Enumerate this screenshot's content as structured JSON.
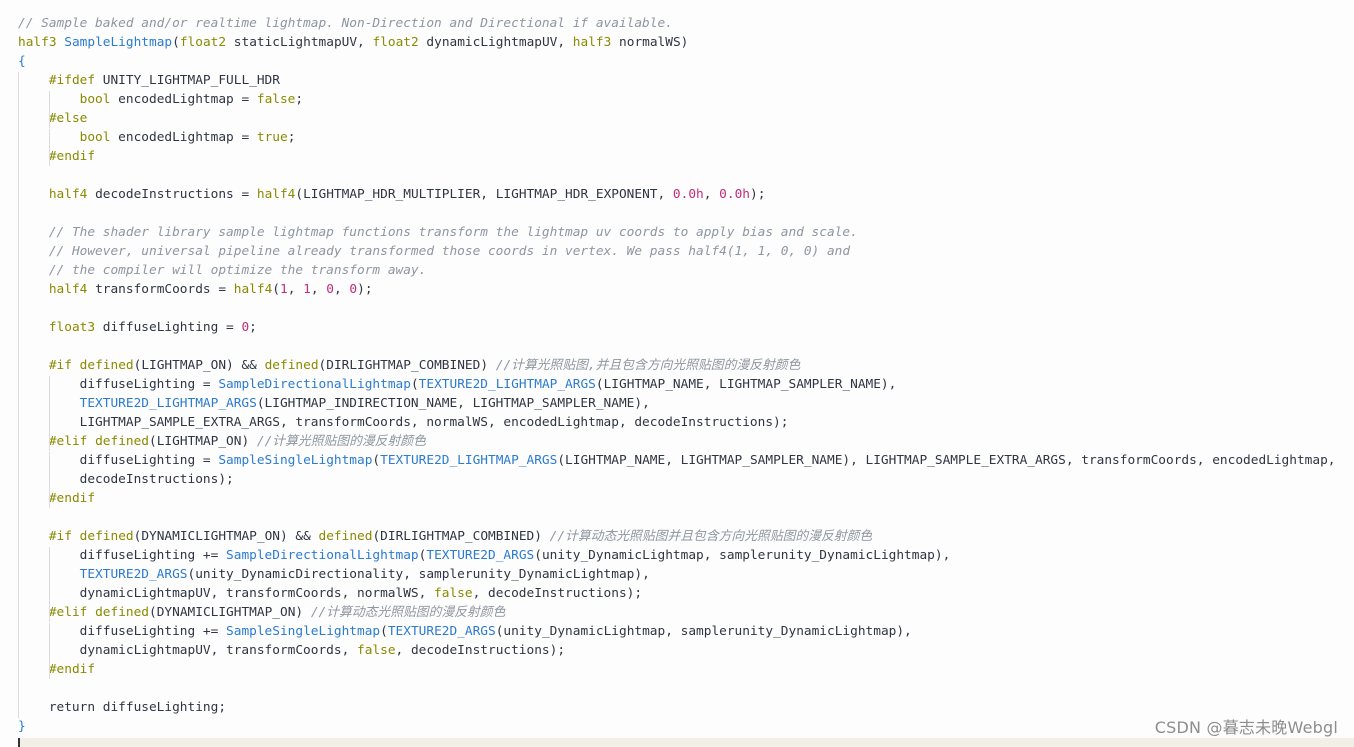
{
  "watermark": "CSDN @暮志未晚Webgl",
  "code_lines": [
    [
      [
        "cm",
        "// Sample baked and/or realtime lightmap. Non-Direction and Directional if available."
      ]
    ],
    [
      [
        "kw",
        "half3"
      ],
      [
        "txt",
        " "
      ],
      [
        "fn",
        "SampleLightmap"
      ],
      [
        "txt",
        "("
      ],
      [
        "kw",
        "float2"
      ],
      [
        "txt",
        " staticLightmapUV, "
      ],
      [
        "kw",
        "float2"
      ],
      [
        "txt",
        " dynamicLightmapUV, "
      ],
      [
        "kw",
        "half3"
      ],
      [
        "txt",
        " normalWS)"
      ]
    ],
    [
      [
        "brace",
        "{"
      ]
    ],
    [
      [
        "txt",
        "    "
      ],
      [
        "pp",
        "#ifdef"
      ],
      [
        "txt",
        " UNITY_LIGHTMAP_FULL_HDR"
      ]
    ],
    [
      [
        "txt",
        "        "
      ],
      [
        "kw",
        "bool"
      ],
      [
        "txt",
        " encodedLightmap = "
      ],
      [
        "kw",
        "false"
      ],
      [
        "txt",
        ";"
      ]
    ],
    [
      [
        "txt",
        "    "
      ],
      [
        "pp",
        "#else"
      ]
    ],
    [
      [
        "txt",
        "        "
      ],
      [
        "kw",
        "bool"
      ],
      [
        "txt",
        " encodedLightmap = "
      ],
      [
        "kw",
        "true"
      ],
      [
        "txt",
        ";"
      ]
    ],
    [
      [
        "txt",
        "    "
      ],
      [
        "pp",
        "#endif"
      ]
    ],
    [],
    [
      [
        "txt",
        "    "
      ],
      [
        "kw",
        "half4"
      ],
      [
        "txt",
        " decodeInstructions = "
      ],
      [
        "kw",
        "half4"
      ],
      [
        "txt",
        "(LIGHTMAP_HDR_MULTIPLIER, LIGHTMAP_HDR_EXPONENT, "
      ],
      [
        "num",
        "0.0h"
      ],
      [
        "txt",
        ", "
      ],
      [
        "num",
        "0.0h"
      ],
      [
        "txt",
        ");"
      ]
    ],
    [],
    [
      [
        "txt",
        "    "
      ],
      [
        "cm",
        "// The shader library sample lightmap functions transform the lightmap uv coords to apply bias and scale."
      ]
    ],
    [
      [
        "txt",
        "    "
      ],
      [
        "cm",
        "// However, universal pipeline already transformed those coords in vertex. We pass half4(1, 1, 0, 0) and"
      ]
    ],
    [
      [
        "txt",
        "    "
      ],
      [
        "cm",
        "// the compiler will optimize the transform away."
      ]
    ],
    [
      [
        "txt",
        "    "
      ],
      [
        "kw",
        "half4"
      ],
      [
        "txt",
        " transformCoords = "
      ],
      [
        "kw",
        "half4"
      ],
      [
        "txt",
        "("
      ],
      [
        "num",
        "1"
      ],
      [
        "txt",
        ", "
      ],
      [
        "num",
        "1"
      ],
      [
        "txt",
        ", "
      ],
      [
        "num",
        "0"
      ],
      [
        "txt",
        ", "
      ],
      [
        "num",
        "0"
      ],
      [
        "txt",
        ");"
      ]
    ],
    [],
    [
      [
        "txt",
        "    "
      ],
      [
        "kw",
        "float3"
      ],
      [
        "txt",
        " diffuseLighting = "
      ],
      [
        "num",
        "0"
      ],
      [
        "txt",
        ";"
      ]
    ],
    [],
    [
      [
        "txt",
        "    "
      ],
      [
        "pp",
        "#if"
      ],
      [
        "txt",
        " "
      ],
      [
        "kw",
        "defined"
      ],
      [
        "txt",
        "(LIGHTMAP_ON) && "
      ],
      [
        "kw",
        "defined"
      ],
      [
        "txt",
        "(DIRLIGHTMAP_COMBINED) "
      ],
      [
        "cm",
        "//计算光照贴图,并且包含方向光照贴图的漫反射颜色"
      ]
    ],
    [
      [
        "txt",
        "        diffuseLighting = "
      ],
      [
        "fn",
        "SampleDirectionalLightmap"
      ],
      [
        "txt",
        "("
      ],
      [
        "fn",
        "TEXTURE2D_LIGHTMAP_ARGS"
      ],
      [
        "txt",
        "(LIGHTMAP_NAME, LIGHTMAP_SAMPLER_NAME),"
      ]
    ],
    [
      [
        "txt",
        "        "
      ],
      [
        "fn",
        "TEXTURE2D_LIGHTMAP_ARGS"
      ],
      [
        "txt",
        "(LIGHTMAP_INDIRECTION_NAME, LIGHTMAP_SAMPLER_NAME),"
      ]
    ],
    [
      [
        "txt",
        "        LIGHTMAP_SAMPLE_EXTRA_ARGS, transformCoords, normalWS, encodedLightmap, decodeInstructions);"
      ]
    ],
    [
      [
        "txt",
        "    "
      ],
      [
        "pp",
        "#elif"
      ],
      [
        "txt",
        " "
      ],
      [
        "kw",
        "defined"
      ],
      [
        "txt",
        "(LIGHTMAP_ON) "
      ],
      [
        "cm",
        "//计算光照贴图的漫反射颜色"
      ]
    ],
    [
      [
        "txt",
        "        diffuseLighting = "
      ],
      [
        "fn",
        "SampleSingleLightmap"
      ],
      [
        "txt",
        "("
      ],
      [
        "fn",
        "TEXTURE2D_LIGHTMAP_ARGS"
      ],
      [
        "txt",
        "(LIGHTMAP_NAME, LIGHTMAP_SAMPLER_NAME), LIGHTMAP_SAMPLE_EXTRA_ARGS, transformCoords, encodedLightmap,"
      ]
    ],
    [
      [
        "txt",
        "        decodeInstructions);"
      ]
    ],
    [
      [
        "txt",
        "    "
      ],
      [
        "pp",
        "#endif"
      ]
    ],
    [],
    [
      [
        "txt",
        "    "
      ],
      [
        "pp",
        "#if"
      ],
      [
        "txt",
        " "
      ],
      [
        "kw",
        "defined"
      ],
      [
        "txt",
        "(DYNAMICLIGHTMAP_ON) && "
      ],
      [
        "kw",
        "defined"
      ],
      [
        "txt",
        "(DIRLIGHTMAP_COMBINED) "
      ],
      [
        "cm",
        "//计算动态光照贴图并且包含方向光照贴图的漫反射颜色"
      ]
    ],
    [
      [
        "txt",
        "        diffuseLighting += "
      ],
      [
        "fn",
        "SampleDirectionalLightmap"
      ],
      [
        "txt",
        "("
      ],
      [
        "fn",
        "TEXTURE2D_ARGS"
      ],
      [
        "txt",
        "(unity_DynamicLightmap, samplerunity_DynamicLightmap),"
      ]
    ],
    [
      [
        "txt",
        "        "
      ],
      [
        "fn",
        "TEXTURE2D_ARGS"
      ],
      [
        "txt",
        "(unity_DynamicDirectionality, samplerunity_DynamicLightmap),"
      ]
    ],
    [
      [
        "txt",
        "        dynamicLightmapUV, transformCoords, normalWS, "
      ],
      [
        "kw",
        "false"
      ],
      [
        "txt",
        ", decodeInstructions);"
      ]
    ],
    [
      [
        "txt",
        "    "
      ],
      [
        "pp",
        "#elif"
      ],
      [
        "txt",
        " "
      ],
      [
        "kw",
        "defined"
      ],
      [
        "txt",
        "(DYNAMICLIGHTMAP_ON) "
      ],
      [
        "cm",
        "//计算动态光照贴图的漫反射颜色"
      ]
    ],
    [
      [
        "txt",
        "        diffuseLighting += "
      ],
      [
        "fn",
        "SampleSingleLightmap"
      ],
      [
        "txt",
        "("
      ],
      [
        "fn",
        "TEXTURE2D_ARGS"
      ],
      [
        "txt",
        "(unity_DynamicLightmap, samplerunity_DynamicLightmap),"
      ]
    ],
    [
      [
        "txt",
        "        dynamicLightmapUV, transformCoords, "
      ],
      [
        "kw",
        "false"
      ],
      [
        "txt",
        ", decodeInstructions);"
      ]
    ],
    [
      [
        "txt",
        "    "
      ],
      [
        "pp",
        "#endif"
      ]
    ],
    [],
    [
      [
        "txt",
        "    return diffuseLighting;"
      ]
    ],
    [
      [
        "brace",
        "}"
      ]
    ]
  ]
}
